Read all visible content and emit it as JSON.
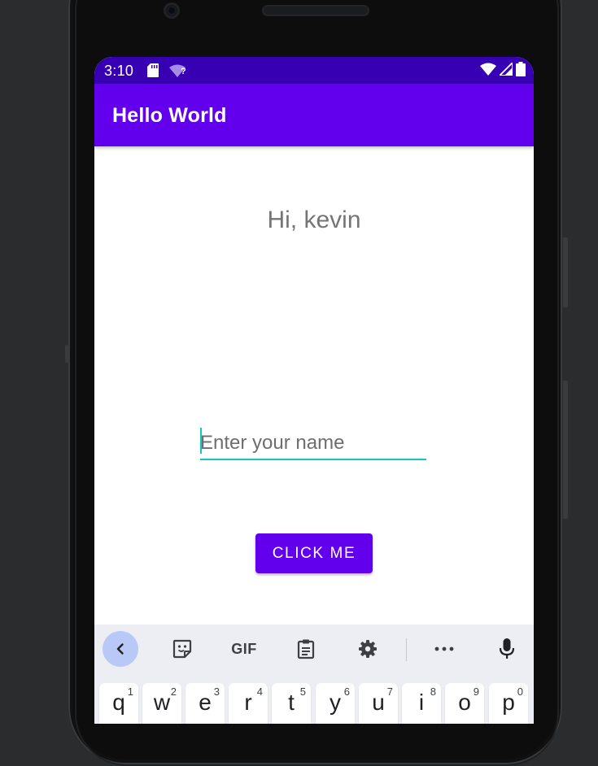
{
  "status_bar": {
    "time": "3:10",
    "icons": [
      "sd-card-icon",
      "wifi-question-icon",
      "wifi-icon",
      "signal-icon",
      "battery-icon"
    ],
    "wifi_question_mark": "?"
  },
  "app_bar": {
    "title": "Hello World"
  },
  "main": {
    "greeting": "Hi, kevin",
    "name_input": {
      "placeholder": "Enter your name",
      "value": ""
    },
    "button_label": "CLICK ME"
  },
  "keyboard": {
    "toolbar": {
      "items": [
        "back-icon",
        "sticker-icon",
        "gif-icon",
        "clipboard-icon",
        "settings-icon",
        "more-icon",
        "microphone-icon"
      ],
      "gif_label": "GIF"
    },
    "keys": [
      {
        "char": "q",
        "num": "1"
      },
      {
        "char": "w",
        "num": "2"
      },
      {
        "char": "e",
        "num": "3"
      },
      {
        "char": "r",
        "num": "4"
      },
      {
        "char": "t",
        "num": "5"
      },
      {
        "char": "y",
        "num": "6"
      },
      {
        "char": "u",
        "num": "7"
      },
      {
        "char": "i",
        "num": "8"
      },
      {
        "char": "o",
        "num": "9"
      },
      {
        "char": "p",
        "num": "0"
      }
    ]
  },
  "colors": {
    "status_bar": "#3700b3",
    "app_bar": "#6200ee",
    "accent": "#14c7c2",
    "keyboard_bg": "#eceef3"
  }
}
